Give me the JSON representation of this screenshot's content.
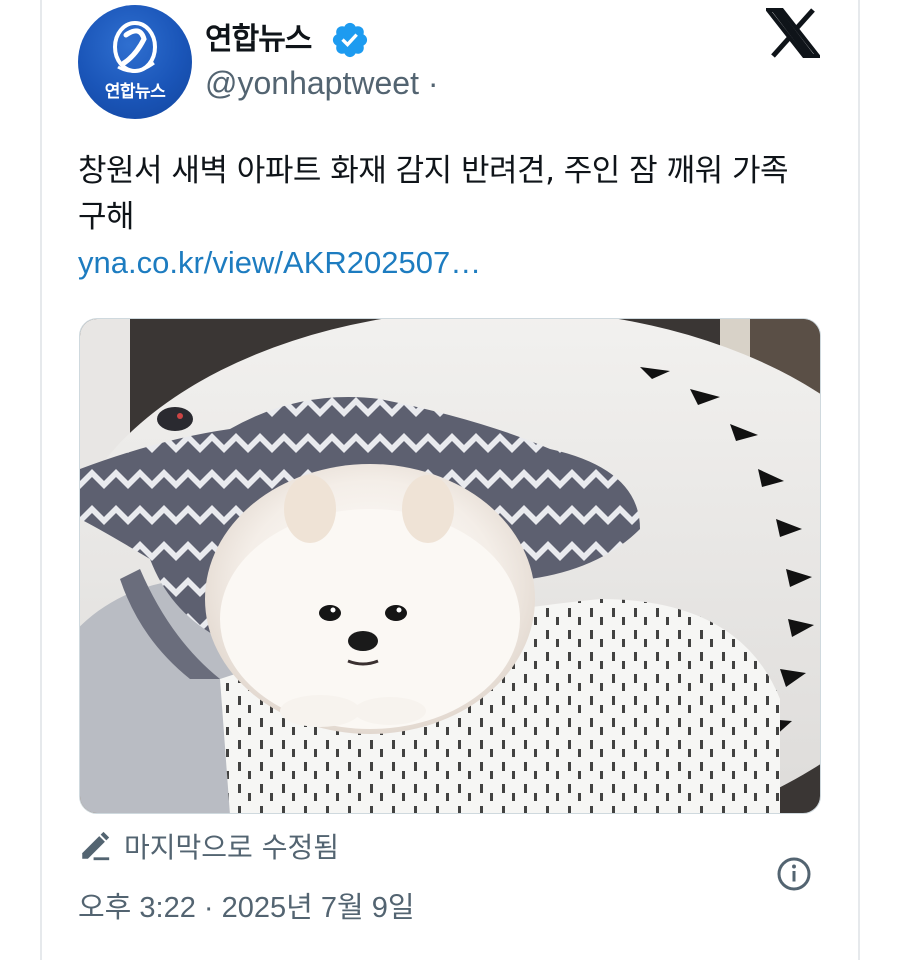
{
  "account": {
    "display_name": "연합뉴스",
    "handle": "@yonhaptweet ·",
    "avatar_text": "연합뉴스",
    "verified": true
  },
  "tweet": {
    "text": "창원서 새벽 아파트 화재 감지 반려견, 주인 잠 깨워 가족 구해",
    "link": "yna.co.kr/view/AKR202507…",
    "image_alt": "Pomeranian dog under a blanket on a pet bed"
  },
  "footer": {
    "edited_label": "마지막으로 수정됨",
    "timestamp": "오후 3:22 · 2025년 7월 9일"
  },
  "icons": {
    "verified": "verified-badge-icon",
    "platform": "x-logo-icon",
    "edit": "pencil-icon",
    "info": "info-icon"
  },
  "colors": {
    "verified_blue": "#1d9bf0",
    "link_blue": "#1d7cc0",
    "muted_text": "#536471",
    "brand_blue": "#1a55b8"
  }
}
